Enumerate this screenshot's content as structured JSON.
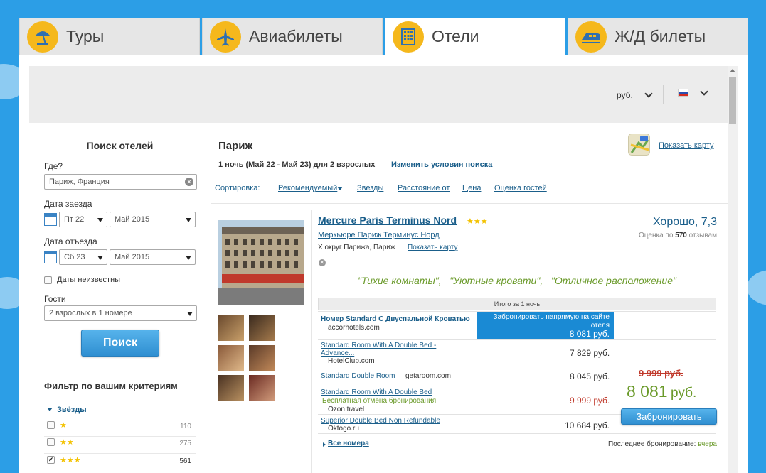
{
  "tabs": [
    {
      "label": "Туры",
      "icon": "palm-umbrella-icon"
    },
    {
      "label": "Авиабилеты",
      "icon": "airplane-icon"
    },
    {
      "label": "Отели",
      "icon": "hotel-building-icon",
      "active": true
    },
    {
      "label": "Ж/Д билеты",
      "icon": "train-icon"
    }
  ],
  "header": {
    "currency": "руб."
  },
  "sidebar": {
    "title": "Поиск отелей",
    "where_label": "Где?",
    "where_value": "Париж, Франция",
    "checkin_label": "Дата заезда",
    "checkin_day": "Пт 22",
    "checkin_month": "Май 2015",
    "checkout_label": "Дата отъезда",
    "checkout_day": "Сб 23",
    "checkout_month": "Май 2015",
    "dates_unknown": "Даты неизвестны",
    "guests_label": "Гости",
    "guests_value": "2 взрослых в 1 номере",
    "search_btn": "Поиск",
    "filter_title": "Фильтр по вашим критериям",
    "stars_label": "Звёзды",
    "stars": [
      {
        "stars": "★",
        "count": "110",
        "checked": false
      },
      {
        "stars": "★★",
        "count": "275",
        "checked": false
      },
      {
        "stars": "★★★",
        "count": "561",
        "checked": true
      }
    ]
  },
  "results": {
    "city": "Париж",
    "summary": "1 ночь (Май 22 - Май 23) для 2 взрослых",
    "change_link": "Изменить условия поиска",
    "show_map": "Показать карту",
    "sort_label": "Сортировка:",
    "sort": [
      "Рекомендуемый",
      "Звезды",
      "Расстояние от",
      "Цена",
      "Оценка гостей"
    ]
  },
  "hotel": {
    "name": "Mercure Paris Terminus Nord",
    "stars": "★★★",
    "name_ru": "Меркьюре Париж Терминус Норд",
    "district": "X округ Парижа, Париж",
    "show_map": "Показать карту",
    "rating": "Хорошо, 7,3",
    "reviews_prefix": "Оценка по",
    "reviews_count": "570",
    "reviews_suffix": "отзывам",
    "quotes": "\"Тихие комнаты\",   \"Уютные кровати\",   \"Отличное расположение\"",
    "total_label": "Итого за 1 ночь",
    "offers": [
      {
        "room": "Номер Standard С Двуспальной Кроватью",
        "provider": "accorhotels.com",
        "price": "8 081 руб.",
        "note": "Забронировать напрямую на сайте отеля"
      },
      {
        "room": "Standard Room With A Double Bed - Advance...",
        "provider": "HotelClub.com",
        "price": "7 829 руб."
      },
      {
        "room": "Standard Double Room",
        "provider": "getaroom.com",
        "price": "8 045 руб."
      },
      {
        "room": "Standard Room With A Double Bed",
        "provider": "Ozon.travel",
        "price": "9 999 руб.",
        "extra": "Бесплатная отмена бронирования"
      },
      {
        "room": "Superior Double Bed Non Refundable",
        "provider": "Oktogo.ru",
        "price": "10 684 руб."
      }
    ],
    "old_price": "9 999 руб.",
    "new_price": "8 081",
    "new_price_unit": "руб.",
    "book_btn": "Забронировать",
    "all_rooms": "Все номера",
    "last_booking_label": "Последнее бронирование:",
    "last_booking_value": "вчера"
  },
  "colors": {
    "accent": "#f5b81c",
    "link": "#1a5e8a",
    "green": "#6a9a2a",
    "blue_btn": "#2f8fd1"
  }
}
